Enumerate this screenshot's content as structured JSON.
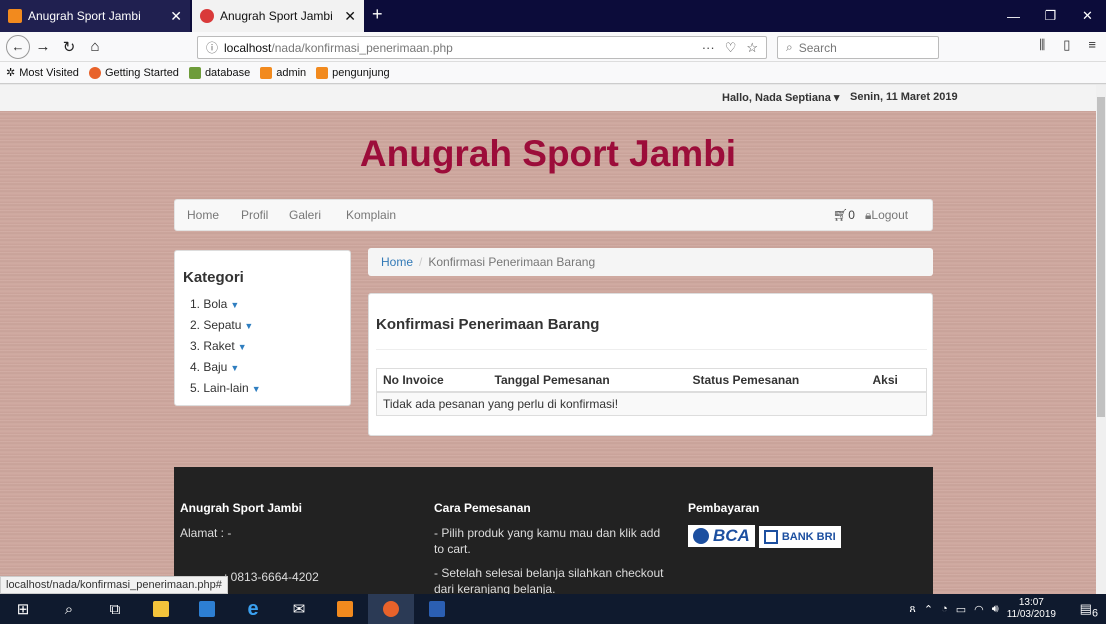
{
  "browser": {
    "tabs": [
      {
        "title": "Anugrah Sport Jambi",
        "active": false
      },
      {
        "title": "Anugrah Sport Jambi",
        "active": true
      }
    ],
    "url_host": "localhost",
    "url_path": "/nada/konfirmasi_penerimaan.php",
    "search_placeholder": "Search",
    "bookmarks": [
      "Most Visited",
      "Getting Started",
      "database",
      "admin",
      "pengunjung"
    ],
    "status_url": "localhost/nada/konfirmasi_penerimaan.php#"
  },
  "page": {
    "greeting": "Hallo, Nada Septiana",
    "date": "Senin, 11 Maret 2019",
    "brand": "Anugrah Sport Jambi",
    "menu": [
      "Home",
      "Profil",
      "Galeri",
      "Komplain"
    ],
    "cart_count": "0",
    "logout": "Logout",
    "sidebar": {
      "title": "Kategori",
      "items": [
        "1. Bola",
        "2. Sepatu",
        "3. Raket",
        "4. Baju",
        "5. Lain-lain"
      ]
    },
    "breadcrumb": {
      "home": "Home",
      "current": "Konfirmasi Penerimaan Barang"
    },
    "panel": {
      "title": "Konfirmasi Penerimaan Barang",
      "columns": [
        "No Invoice",
        "Tanggal Pemesanan",
        "Status Pemesanan",
        "Aksi"
      ],
      "empty_message": "Tidak ada pesanan yang perlu di konfirmasi!"
    },
    "footer": {
      "col1": {
        "title": "Anugrah Sport Jambi",
        "alamat": "Alamat : -",
        "telp": ": 0813-6664-4202"
      },
      "col2": {
        "title": "Cara Pemesanan",
        "step1": "- Pilih produk yang kamu mau dan klik add to cart.",
        "step2": "- Setelah selesai belanja silahkan checkout dari keranjang belanja."
      },
      "col3": {
        "title": "Pembayaran",
        "bank1": "BCA",
        "bank2": "BANK BRI"
      }
    }
  },
  "taskbar": {
    "time": "13:07",
    "date": "11/03/2019",
    "notifications": "6"
  },
  "colors": {
    "brand": "#9c0d3a",
    "link": "#337ab7",
    "footer_bg": "#222222"
  }
}
